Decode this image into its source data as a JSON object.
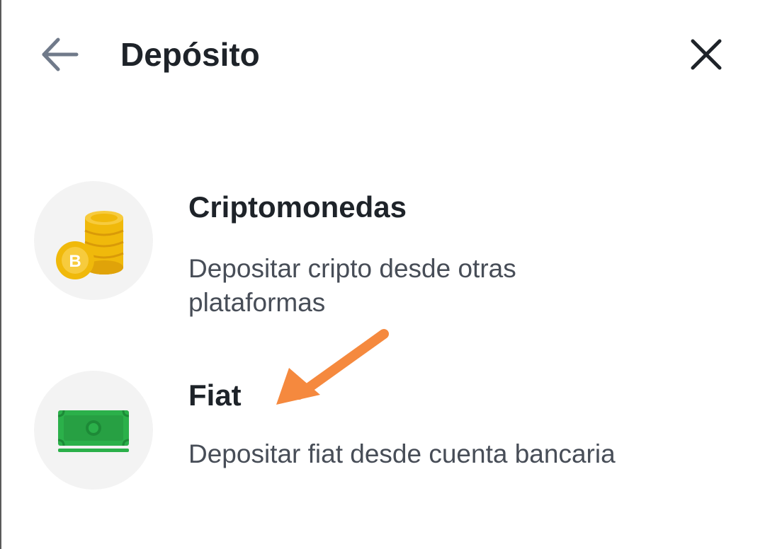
{
  "header": {
    "title": "Depósito",
    "back_icon": "arrow-left-icon",
    "close_icon": "close-icon"
  },
  "options": [
    {
      "title": "Criptomonedas",
      "description": "Depositar cripto desde otras plataformas",
      "icon": "crypto-coins-icon",
      "coin_glyph": "B"
    },
    {
      "title": "Fiat",
      "description": "Depositar fiat desde cuenta bancaria",
      "icon": "banknote-icon"
    }
  ],
  "annotation": {
    "icon": "arrow-pointer-icon",
    "color": "#f5893e"
  },
  "colors": {
    "text_primary": "#1e2329",
    "text_secondary": "#474d57",
    "icon_bg": "#f3f3f3",
    "coin_gold": "#f0b90b",
    "banknote_green": "#2bb04a"
  }
}
